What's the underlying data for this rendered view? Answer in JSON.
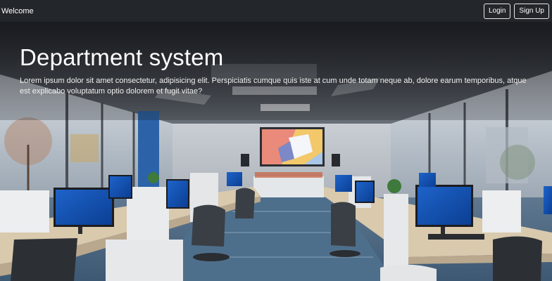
{
  "navbar": {
    "brand": "Welcome",
    "login_label": "Login",
    "signup_label": "Sign Up"
  },
  "hero": {
    "title": "Department system",
    "text": "Lorem ipsum dolor sit amet consectetur, adipisicing elit. Perspiciatis cumque quis iste at cum unde totam neque ab, dolore earum temporibus, atque est explicabo voluptatum optio dolorem et fugit vitae?"
  },
  "colors": {
    "navbar_bg": "#23262a",
    "text": "#ffffff",
    "button_border": "#e8e8e8"
  }
}
